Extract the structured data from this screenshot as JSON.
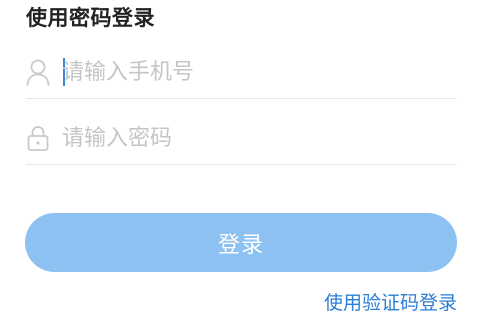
{
  "header": {
    "title": "使用密码登录"
  },
  "form": {
    "phone": {
      "value": "",
      "placeholder": "请输入手机号",
      "icon": "user-icon"
    },
    "password": {
      "value": "",
      "placeholder": "请输入密码",
      "icon": "lock-icon"
    },
    "submit_label": "登录",
    "alt_login_label": "使用验证码登录"
  },
  "colors": {
    "accent": "#2a7ed8",
    "button_bg": "#8dc1f2",
    "caret": "#3a86e0",
    "placeholder": "#c5c5c5",
    "divider": "#e6e6e6",
    "title": "#222222"
  }
}
